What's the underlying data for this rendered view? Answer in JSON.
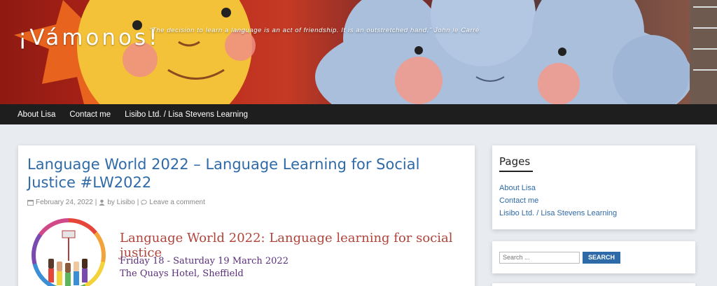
{
  "site": {
    "title": "¡Vámonos!",
    "tagline": "\"The decision to learn a language is an act of friendship. It is an outstretched hand.\" John le Carré"
  },
  "nav": {
    "items": [
      "About Lisa",
      "Contact me",
      "Lisibo Ltd. / Lisa Stevens Learning"
    ]
  },
  "post": {
    "title": "Language World 2022 – Language Learning for Social Justice #LW2022",
    "date": "February 24, 2022",
    "separator": "|",
    "author": "by Lisibo",
    "comments": "Leave a comment",
    "image": {
      "heading": "Language World 2022: Language learning for social justice",
      "dates": "Friday 18 - Saturday 19 March 2022",
      "venue": "The Quays Hotel, Sheffield"
    }
  },
  "sidebar": {
    "pages_title": "Pages",
    "pages": [
      "About Lisa",
      "Contact me",
      "Lisibo Ltd. / Lisa Stevens Learning"
    ],
    "search_placeholder": "Search ...",
    "search_button": "SEARCH"
  }
}
